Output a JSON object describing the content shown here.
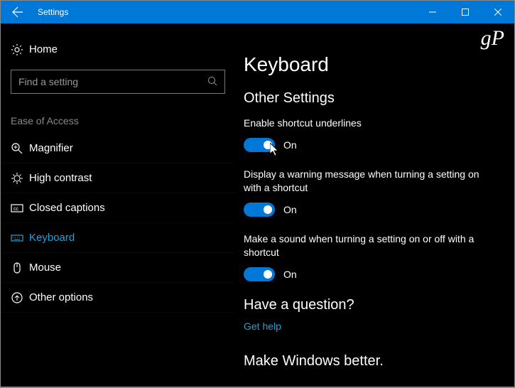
{
  "titleBar": {
    "title": "Settings"
  },
  "watermark": "gP",
  "sidebar": {
    "home": "Home",
    "searchPlaceholder": "Find a setting",
    "sectionLabel": "Ease of Access",
    "items": [
      {
        "label": "Magnifier"
      },
      {
        "label": "High contrast"
      },
      {
        "label": "Closed captions"
      },
      {
        "label": "Keyboard"
      },
      {
        "label": "Mouse"
      },
      {
        "label": "Other options"
      }
    ]
  },
  "main": {
    "pageTitle": "Keyboard",
    "sectionTitle": "Other Settings",
    "settings": [
      {
        "label": "Enable shortcut underlines",
        "state": "On"
      },
      {
        "label": "Display a warning message when turning a setting on with a shortcut",
        "state": "On"
      },
      {
        "label": "Make a sound when turning a setting on or off with a shortcut",
        "state": "On"
      }
    ],
    "helpTitle": "Have a question?",
    "helpLink": "Get help",
    "feedbackTitle": "Make Windows better."
  }
}
